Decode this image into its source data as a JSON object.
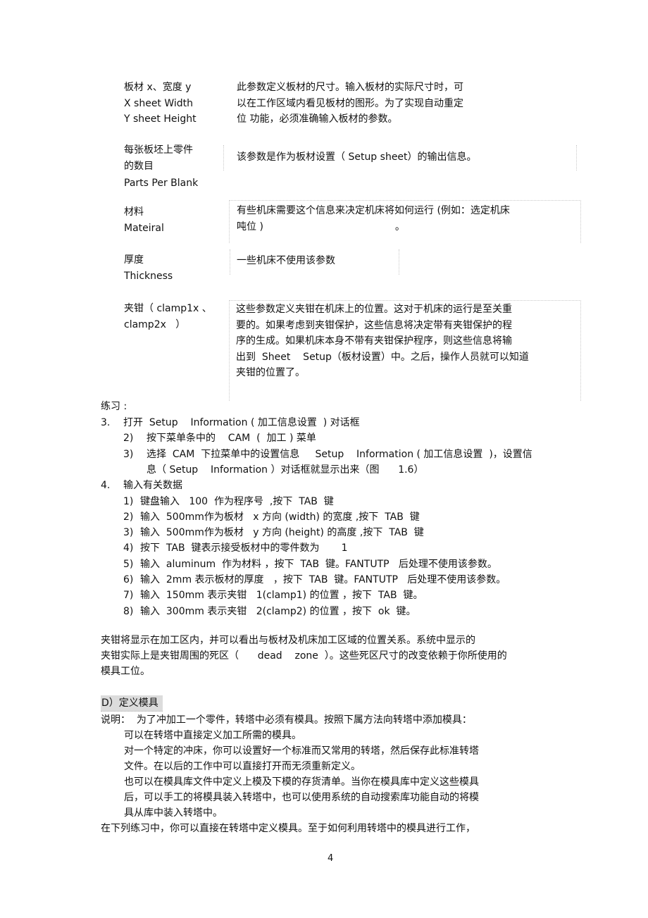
{
  "params": [
    {
      "label_lines": [
        "板材  x、宽度  y",
        "X sheet Width",
        "Y sheet Height"
      ],
      "desc_lines": [
        "此参数定义板材的尺寸。输入板材的实际尺寸时，可",
        "以在工作区域内看见板材的图形。为了实现自动重定",
        "位   功能，必须准确输入板材的参数。"
      ]
    },
    {
      "label_lines": [
        "每张板坯上零件",
        "的数目",
        "Parts Per Blank"
      ],
      "desc_lines": [
        "该参数是作为板材设置（    Setup    sheet）的输出信息。"
      ]
    },
    {
      "label_lines": [
        "材料",
        "Mateiral"
      ],
      "desc_lines": [
        "有些机床需要这个信息来决定机床将如何运行        (例如：选定机床",
        "吨位 )                                          。"
      ]
    },
    {
      "label_lines": [
        "厚度",
        "Thickness"
      ],
      "desc_lines": [
        "一些机床不使用该参数"
      ]
    },
    {
      "label_lines": [
        "夹钳（ clamp1x 、",
        "clamp2x   ）"
      ],
      "desc_lines": [
        "这些参数定义夹钳在机床上的位置。这对于机床的运行是至关重",
        "要的。如果考虑到夹钳保护，这些信息将决定带有夹钳保护的程",
        "序的生成。如果机床本身不带有夹钳保护程序，则这些信息将输",
        "出到  Sheet    Setup（板材设置）中。之后，操作人员就可以知道",
        "夹钳的位置了。"
      ]
    }
  ],
  "exercise": {
    "title": "练习 :",
    "steps": [
      {
        "num": "3.",
        "text": "打开  Setup    Information ( 加工信息设置  ) 对话框",
        "substeps": [
          {
            "num": "2)",
            "text": "按下菜单条中的    CAM  (  加工 ) 菜单"
          },
          {
            "num": "3)",
            "text": "选择  CAM  下拉菜单中的设置信息     Setup    Information ( 加工信息设置  )，设置信",
            "cont": "息（ Setup    Information ）对话框就显示出来（图      1.6）"
          }
        ]
      },
      {
        "num": "4.",
        "text": "输入有关数据",
        "substeps": [
          {
            "num": "1)",
            "text": "键盘输入   100  作为程序号  ,按下  TAB  键"
          },
          {
            "num": "2)",
            "text": "输入  500mm作为板材   x 方向 (width) 的宽度 ,按下  TAB  键"
          },
          {
            "num": "3)",
            "text": "输入  500mm作为板材   y 方向 (height) 的高度 ,按下  TAB  键"
          },
          {
            "num": "4)",
            "text": "按下  TAB  键表示接受板材中的零件数为       1"
          },
          {
            "num": "5)",
            "text": "输入  aluminum  作为材料 ，按下  TAB  键。FANTUTP   后处理不使用该参数。"
          },
          {
            "num": "6)",
            "text": "输入  2mm 表示板材的厚度   ，按下  TAB  键。FANTUTP   后处理不使用该参数。"
          },
          {
            "num": "7)",
            "text": "输入  150mm 表示夹钳   1(clamp1) 的位置 ，按下  TAB  键。"
          },
          {
            "num": "8)",
            "text": "输入  300mm 表示夹钳   2(clamp2) 的位置 ，按下  ok  键。"
          }
        ]
      }
    ]
  },
  "clamp_paragraph": [
    "夹钳将显示在加工区内，并可以看出与板材及机床加工区域的位置关系。系统中显示的",
    "夹钳实际上是夹钳周围的死区（      dead    zone  ）。这些死区尺寸的改变依赖于你所使用的",
    "模具工位。"
  ],
  "section_d": {
    "heading": "D）定义模具",
    "intro": "说明：  为了冲加工一个零件，转塔中必须有模具。按照下属方法向转塔中添加模具：",
    "items": [
      [
        "可以在转塔中直接定义加工所需的模具。"
      ],
      [
        "对一个特定的冲床，你可以设置好一个标准而又常用的转塔，然后保存此标准转塔",
        "文件。在以后的工作中可以直接打开而无须重新定义。"
      ],
      [
        "也可以在模具库文件中定义上模及下模的存货清单。当你在模具库中定义这些模具",
        "后，可以手工的将模具装入转塔中，也可以使用系统的自动搜索库功能自动的将模",
        "具从库中装入转塔中。"
      ]
    ],
    "closing": "在下列练习中，你可以直接在转塔中定义模具。至于如何利用转塔中的模具进行工作，"
  },
  "page_number": "4"
}
